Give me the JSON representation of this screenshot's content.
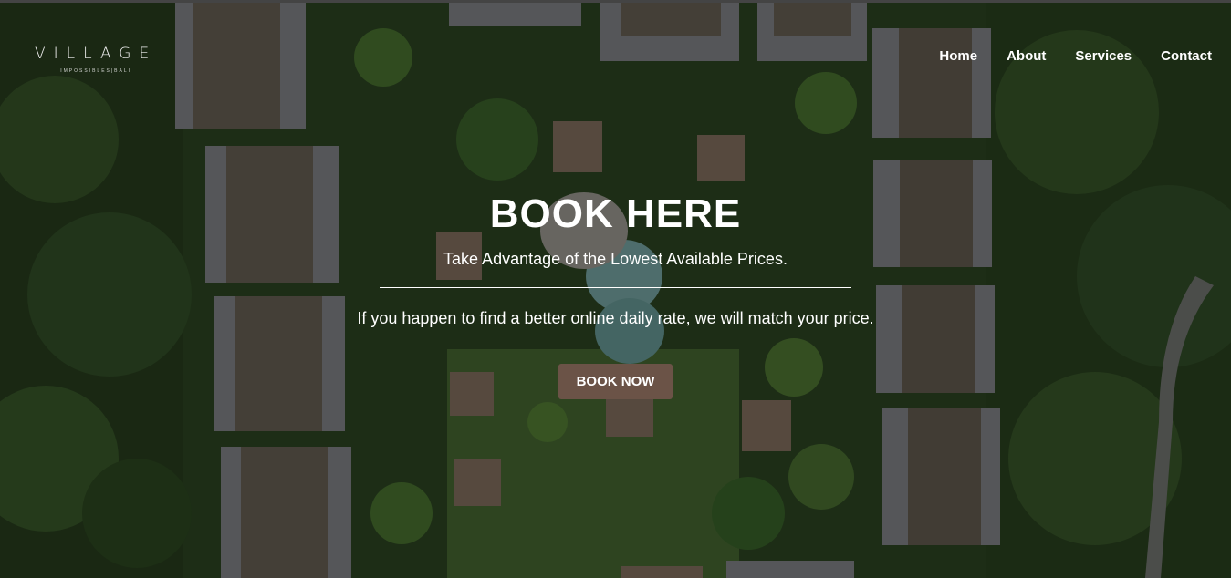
{
  "brand": {
    "name": "VILLAGE",
    "tagline": "IMPOSSIBLES|BALI"
  },
  "nav": {
    "items": [
      {
        "label": "Home"
      },
      {
        "label": "About"
      },
      {
        "label": "Services"
      },
      {
        "label": "Contact"
      }
    ]
  },
  "hero": {
    "title": "BOOK HERE",
    "subtitle": "Take Advantage of the Lowest Available Prices.",
    "description": "If you happen to find a better online daily rate, we will match your price.",
    "cta_label": "BOOK NOW"
  },
  "colors": {
    "button": "#6b5347",
    "text": "#ffffff",
    "overlay": "rgba(0,0,0,0.38)"
  }
}
